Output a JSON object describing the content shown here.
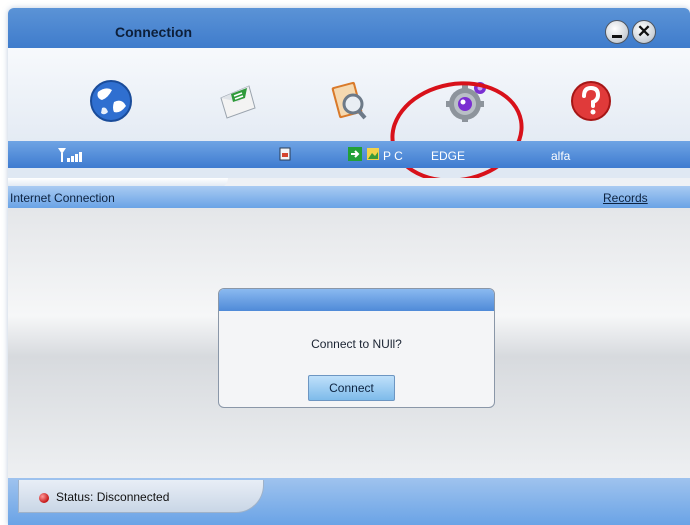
{
  "window": {
    "title": "Connection"
  },
  "titlebar": {
    "minimize": "minimize-icon",
    "close_glyph": "✕"
  },
  "toolbar": {
    "items": [
      {
        "name": "internet-connection",
        "icon": "globe-icon"
      },
      {
        "name": "messages",
        "icon": "mail-icon"
      },
      {
        "name": "phonebook",
        "icon": "contacts-book-icon"
      },
      {
        "name": "settings",
        "icon": "gear-icon"
      },
      {
        "name": "help",
        "icon": "help-icon"
      }
    ]
  },
  "status_strip": {
    "pc_label": "P C",
    "network_type": "EDGE",
    "operator": "alfa"
  },
  "panel": {
    "title": "Internet Connection",
    "records_link": "Records"
  },
  "dialog": {
    "message": "Connect to NUll?",
    "button": "Connect"
  },
  "status": {
    "text": "Status: Disconnected"
  },
  "colors": {
    "accent": "#3f7ccc",
    "annotation": "#d8111a",
    "status_dot": "#c41414"
  }
}
